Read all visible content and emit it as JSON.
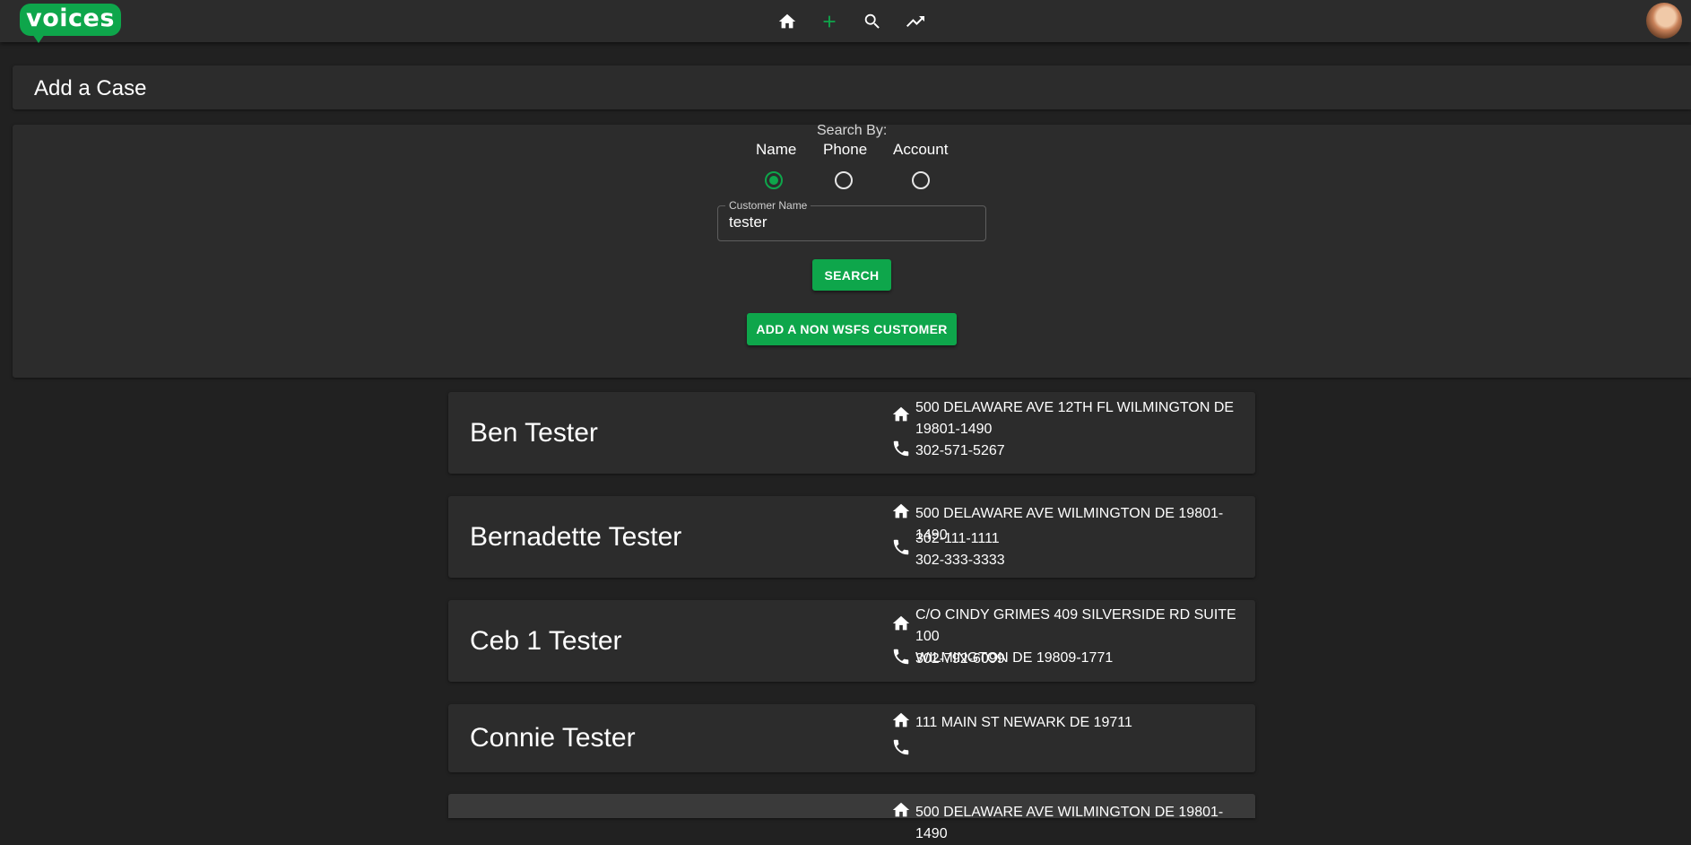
{
  "app": {
    "logo_text": "voices",
    "brand_color": "#0ea64b",
    "nav_icons": [
      "home-icon",
      "plus-icon",
      "search-icon",
      "trending-up-icon"
    ]
  },
  "page": {
    "title": "Add a Case"
  },
  "search": {
    "label": "Search By:",
    "options": [
      "Name",
      "Phone",
      "Account"
    ],
    "selected": "Name",
    "field_label": "Customer Name",
    "field_value": "tester",
    "search_button": "SEARCH",
    "add_button": "ADD A NON WSFS CUSTOMER"
  },
  "results": [
    {
      "name": "Ben Tester",
      "address_lines": [
        "500 DELAWARE AVE 12TH FL WILMINGTON DE",
        "19801-1490"
      ],
      "phones": [
        "302-571-5267"
      ]
    },
    {
      "name": "Bernadette Tester",
      "address_lines": [
        "500 DELAWARE AVE WILMINGTON DE 19801-1490"
      ],
      "phones": [
        "302-111-1111",
        "302-333-3333"
      ]
    },
    {
      "name": "Ceb 1 Tester",
      "address_lines": [
        "C/O CINDY GRIMES 409 SILVERSIDE RD SUITE 100",
        "WILMINGTON DE 19809-1771"
      ],
      "phones": [
        "302-792-6099"
      ]
    },
    {
      "name": "Connie Tester",
      "address_lines": [
        "111 MAIN ST NEWARK DE 19711"
      ],
      "phones": []
    },
    {
      "name": "",
      "address_lines": [
        "500 DELAWARE AVE WILMINGTON DE 19801-1490"
      ],
      "phones": []
    }
  ]
}
